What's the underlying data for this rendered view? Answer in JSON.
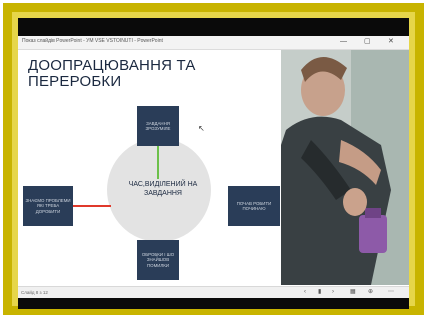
{
  "window": {
    "title": "Показ слайдів PowerPoint - УМ VSE VSTOINUTI - PowerPoint",
    "minimize_glyph": "—",
    "maximize_glyph": "▢",
    "close_glyph": "✕"
  },
  "slide": {
    "title": "ДООПРАЦЮВАННЯ ТА ПЕРЕРОБКИ",
    "center": "ЧАС,ВИДІЛЕНИЙ НА ЗАВДАННЯ",
    "boxes": {
      "top": "ЗАВДАННЯ ЗРОЗУМІЛЕ",
      "left": "ЗНАЄМО ПРОБЛЕМИ ЯКІ ТРЕБА ДОРОБИТИ",
      "right": "ПОЧАВ РОБИТИ ПОЧИНАЮ",
      "bottom": "ОБРОБКИ І ШО ЗНАЙШОВ ПОМИЛКИ"
    },
    "colors": {
      "box_fill": "#2a3d58",
      "connector_top": "#6cc04a",
      "connector_left": "#e0392b"
    }
  },
  "statusbar": {
    "left_text": "Слайд 8 з 12",
    "icons": [
      "prev-icon",
      "pause-icon",
      "next-icon",
      "grid-icon",
      "zoom-icon",
      "menu-icon"
    ]
  },
  "frame": {
    "color": "#c8b400"
  }
}
